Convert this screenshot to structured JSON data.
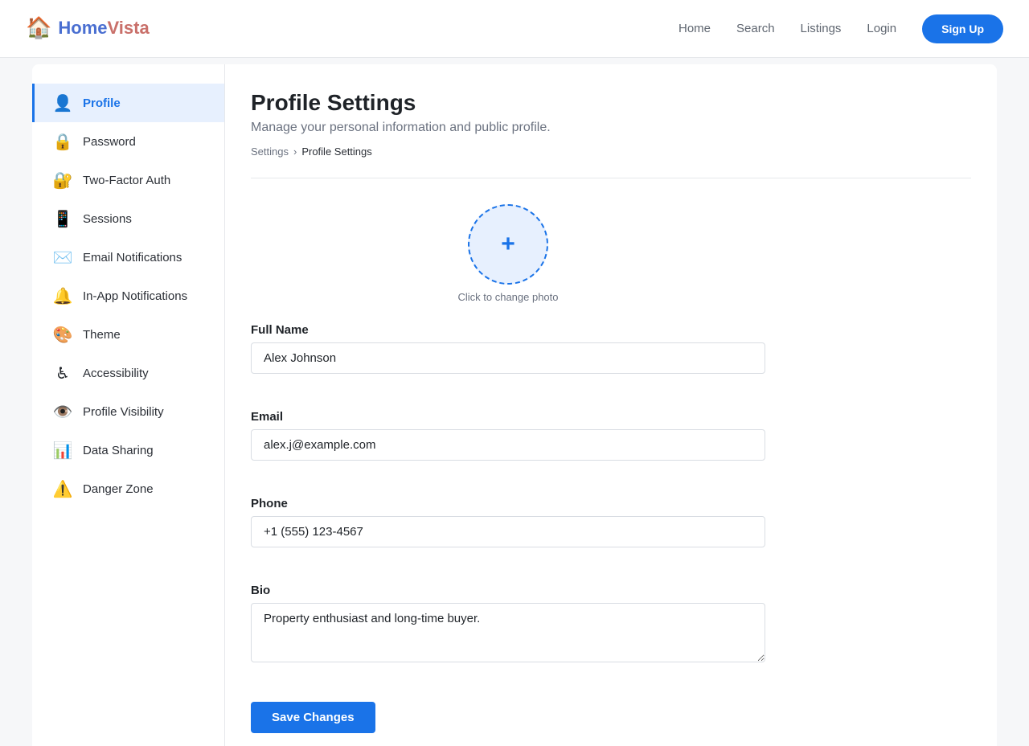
{
  "header": {
    "brand_icon": "house-icon",
    "brand_glyph": "🏠",
    "brand_part1": "Home",
    "brand_part2": "Vista",
    "nav": [
      "Home",
      "Search",
      "Listings",
      "Login"
    ],
    "signup_label": "Sign Up"
  },
  "sidebar": {
    "items": [
      {
        "label": "Profile",
        "icon": "👤",
        "icon_name": "user-icon",
        "active": true
      },
      {
        "label": "Password",
        "icon": "🔒",
        "icon_name": "lock-icon",
        "active": false
      },
      {
        "label": "Two-Factor Auth",
        "icon": "🔐",
        "icon_name": "lock-key-icon",
        "active": false
      },
      {
        "label": "Sessions",
        "icon": "📱",
        "icon_name": "phone-icon",
        "active": false
      },
      {
        "label": "Email Notifications",
        "icon": "✉️",
        "icon_name": "envelope-icon",
        "active": false
      },
      {
        "label": "In-App Notifications",
        "icon": "🔔",
        "icon_name": "bell-icon",
        "active": false
      },
      {
        "label": "Theme",
        "icon": "🎨",
        "icon_name": "palette-icon",
        "active": false
      },
      {
        "label": "Accessibility",
        "icon": "♿",
        "icon_name": "wheelchair-icon",
        "active": false
      },
      {
        "label": "Profile Visibility",
        "icon": "👁️",
        "icon_name": "eye-icon",
        "active": false
      },
      {
        "label": "Data Sharing",
        "icon": "📊",
        "icon_name": "bar-chart-icon",
        "active": false
      },
      {
        "label": "Danger Zone",
        "icon": "⚠️",
        "icon_name": "warning-icon",
        "active": false
      }
    ]
  },
  "main": {
    "title": "Profile Settings",
    "subtitle": "Manage your personal information and public profile.",
    "breadcrumb": {
      "parent": "Settings",
      "separator": "›",
      "current": "Profile Settings"
    },
    "avatar": {
      "plus": "+",
      "caption": "Click to change photo"
    },
    "fields": {
      "full_name": {
        "label": "Full Name",
        "value": "Alex Johnson"
      },
      "email": {
        "label": "Email",
        "value": "alex.j@example.com"
      },
      "phone": {
        "label": "Phone",
        "value": "+1 (555) 123-4567"
      },
      "bio": {
        "label": "Bio",
        "value": "Property enthusiast and long-time buyer."
      }
    },
    "save_label": "Save Changes"
  },
  "colors": {
    "accent": "#1a73e8",
    "brand_home": "#4a6fd1",
    "brand_vista": "#c9706a",
    "active_bg": "#e7f0fe"
  }
}
